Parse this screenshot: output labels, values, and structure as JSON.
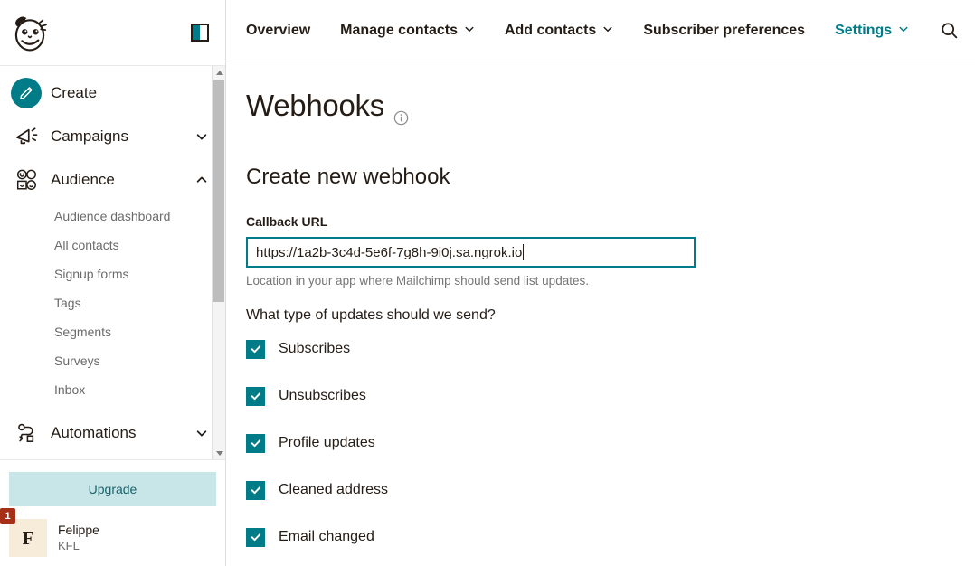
{
  "sidebar": {
    "logo_icon": "mailchimp-freddie-logo",
    "panel_toggle_icon": "panel-toggle-icon",
    "nav": [
      {
        "label": "Create",
        "icon": "pencil-icon",
        "chevron": "",
        "type": "primary"
      },
      {
        "label": "Campaigns",
        "icon": "megaphone-icon",
        "chevron": "v",
        "type": "group"
      },
      {
        "label": "Audience",
        "icon": "audience-icon",
        "chevron": "^",
        "type": "group"
      },
      {
        "label": "Automations",
        "icon": "automations-icon",
        "chevron": "v",
        "type": "group"
      }
    ],
    "audience_subitems": [
      "Audience dashboard",
      "All contacts",
      "Signup forms",
      "Tags",
      "Segments",
      "Surveys",
      "Inbox"
    ],
    "upgrade_label": "Upgrade",
    "user": {
      "avatar_initial": "F",
      "badge_count": "1",
      "name": "Felippe",
      "org": "KFL"
    },
    "scrollbar": {
      "up_icon": "scroll-up-arrow-icon",
      "down_icon": "scroll-down-arrow-icon"
    }
  },
  "topbar": {
    "tabs": [
      {
        "label": "Overview",
        "chevron": "",
        "active": false
      },
      {
        "label": "Manage contacts",
        "chevron": "v",
        "active": false
      },
      {
        "label": "Add contacts",
        "chevron": "v",
        "active": false
      },
      {
        "label": "Subscriber preferences",
        "chevron": "",
        "active": false
      },
      {
        "label": "Settings",
        "chevron": "v",
        "active": true
      }
    ],
    "search_icon": "search-icon"
  },
  "page": {
    "title": "Webhooks",
    "title_info_icon": "info-icon",
    "section_title": "Create new webhook",
    "callback_label": "Callback URL",
    "callback_value": "https://1a2b-3c4d-5e6f-7g8h-9i0j.sa.ngrok.io",
    "callback_placeholder": "https://",
    "help_text": "Location in your app where Mailchimp should send list updates.",
    "question": "What type of updates should we send?",
    "update_types": [
      {
        "label": "Subscribes",
        "checked": true
      },
      {
        "label": "Unsubscribes",
        "checked": true
      },
      {
        "label": "Profile updates",
        "checked": true
      },
      {
        "label": "Cleaned address",
        "checked": true
      },
      {
        "label": "Email changed",
        "checked": true
      }
    ]
  },
  "colors": {
    "teal": "#007c89",
    "upgrade_bg": "#c8e5e8",
    "badge_red": "#a62f17",
    "text": "#241c15",
    "muted": "#757575"
  }
}
